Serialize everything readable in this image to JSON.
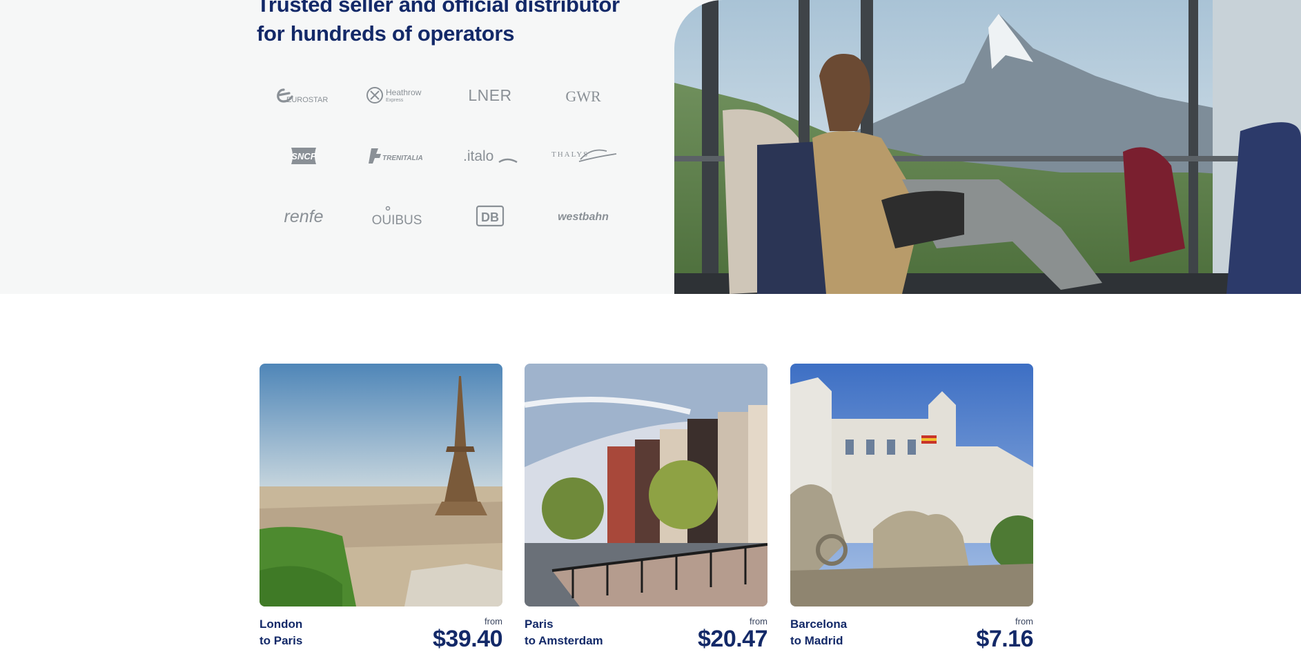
{
  "operators_section": {
    "headline_line1": "Trusted seller and official distributor",
    "headline_line2": "for hundreds of operators",
    "logos": [
      {
        "name": "eurostar-logo",
        "text": "EUROSTAR"
      },
      {
        "name": "heathrow-express-logo",
        "text": "Heathrow",
        "subtext": "Express"
      },
      {
        "name": "lner-logo",
        "text": "LNER"
      },
      {
        "name": "gwr-logo",
        "text": "GWR"
      },
      {
        "name": "sncf-logo",
        "text": "SNCF"
      },
      {
        "name": "trenitalia-logo",
        "text": "TRENITALIA"
      },
      {
        "name": "italo-logo",
        "text": ".italo"
      },
      {
        "name": "thalys-logo",
        "text": "THALYS"
      },
      {
        "name": "renfe-logo",
        "text": "renfe"
      },
      {
        "name": "ouibus-logo",
        "text": "OUIBUS"
      },
      {
        "name": "db-logo",
        "text": "DB"
      },
      {
        "name": "westbahn-logo",
        "text": "westbahn"
      }
    ],
    "logo_color": "#8a9096"
  },
  "hero": {
    "image_icon": "train-window-mountain-photo"
  },
  "routes": [
    {
      "origin": "London",
      "destination": "to Paris",
      "from_label": "from",
      "price": "$39.40",
      "image_icon": "eiffel-tower-photo"
    },
    {
      "origin": "Paris",
      "destination": "to Amsterdam",
      "from_label": "from",
      "price": "$20.47",
      "image_icon": "amsterdam-canal-photo"
    },
    {
      "origin": "Barcelona",
      "destination": "to Madrid",
      "from_label": "from",
      "price": "$7.16",
      "image_icon": "madrid-cibeles-photo"
    }
  ],
  "colors": {
    "text_primary": "#132968",
    "band_background": "#f6f7f7"
  }
}
